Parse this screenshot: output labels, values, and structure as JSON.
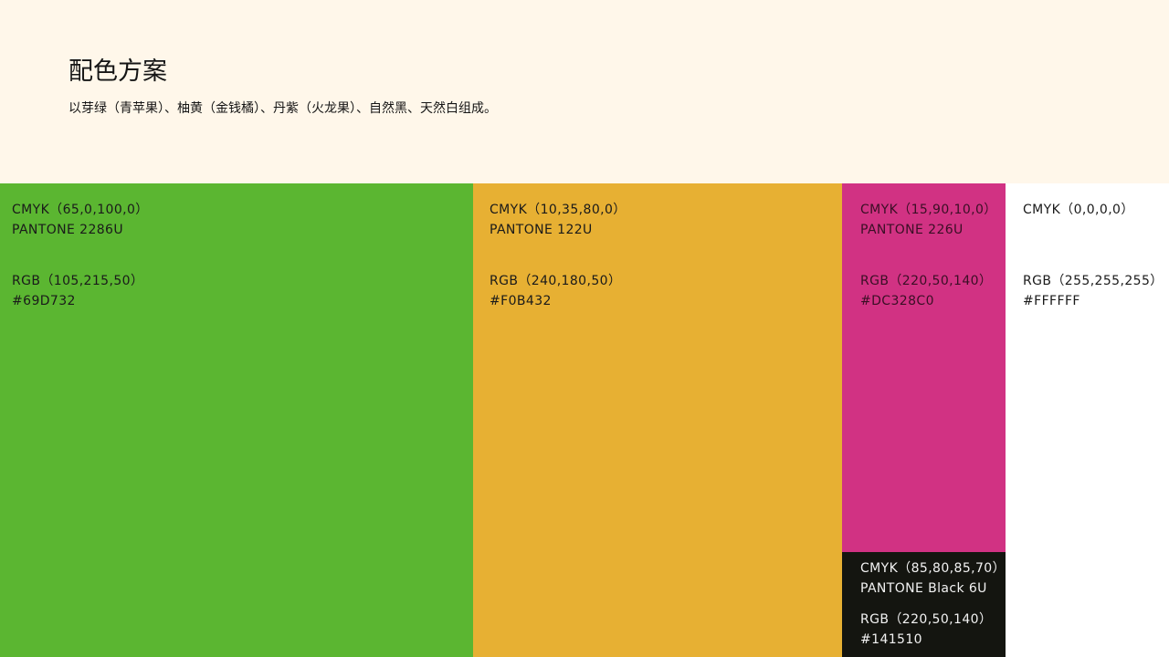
{
  "header": {
    "title": "配色方案",
    "subtitle": "以芽绿（青苹果）、柚黄（金钱橘）、丹紫（火龙果）、自然黑、天然白组成。"
  },
  "swatches": {
    "green": {
      "color": "#5BB631",
      "cmyk": "CMYK（65,0,100,0）",
      "pantone": "PANTONE  2286U",
      "rgb": "RGB（105,215,50）",
      "hex": "#69D732"
    },
    "yellow": {
      "color": "#E7B033",
      "cmyk": "CMYK（10,35,80,0）",
      "pantone": "PANTONE  122U",
      "rgb": "RGB（240,180,50）",
      "hex": "#F0B432"
    },
    "pink": {
      "color": "#D13283",
      "cmyk": "CMYK（15,90,10,0）",
      "pantone": "PANTONE  226U",
      "rgb": "RGB（220,50,140）",
      "hex": "#DC328C0"
    },
    "black": {
      "color": "#141510",
      "cmyk": "CMYK（85,80,85,70）",
      "pantone": "PANTONE  Black 6U",
      "rgb": "RGB（220,50,140）",
      "hex": "#141510"
    },
    "white": {
      "color": "#FFFFFF",
      "cmyk": "CMYK（0,0,0,0）",
      "rgb": "RGB（255,255,255）",
      "hex": "#FFFFFF"
    }
  }
}
